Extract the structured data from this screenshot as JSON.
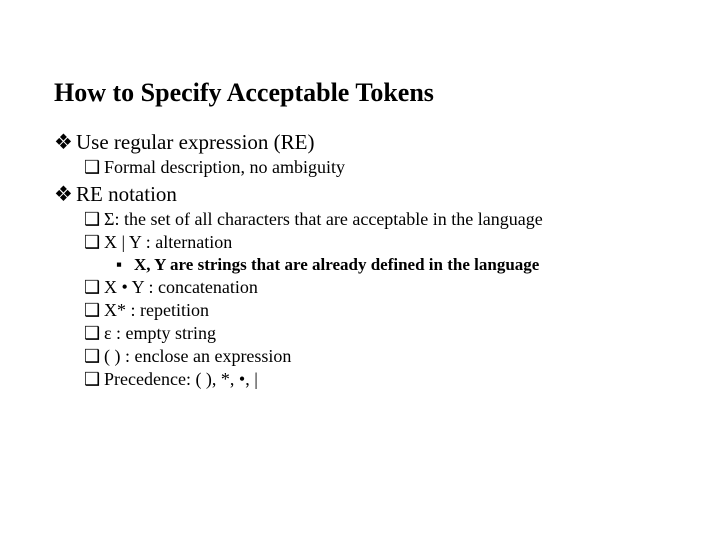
{
  "title": "How to Specify Acceptable Tokens",
  "bullets": {
    "b1": "Use regular expression (RE)",
    "b1_1": "Formal description, no ambiguity",
    "b2": "RE notation",
    "b2_1": "Σ: the set of all characters that are acceptable in the language",
    "b2_2": "X | Y : alternation",
    "b2_2_1": "X, Y are strings that are already defined in the language",
    "b2_3": "X • Y : concatenation",
    "b2_4": "X* : repetition",
    "b2_5": "ε : empty string",
    "b2_6": "( ) : enclose an expression",
    "b2_7": "Precedence:  ( ), *, •, |"
  },
  "glyphs": {
    "diamond": "❖",
    "square": "❑",
    "blacksquare": "▪"
  }
}
